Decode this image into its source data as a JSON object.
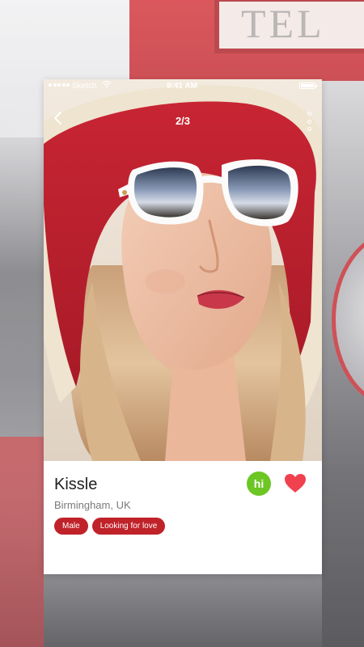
{
  "status_bar": {
    "carrier": "Sketch",
    "time": "9:41 AM",
    "wifi_icon": "wifi-icon",
    "battery_icon": "battery-icon"
  },
  "background": {
    "sign_text": "TEL"
  },
  "header": {
    "back_icon": "chevron-left-icon",
    "photo_counter": "2/3",
    "more_icon": "more-vertical-icon"
  },
  "profile": {
    "name": "Kissle",
    "location": "Birmingham, UK",
    "tags": [
      "Male",
      "Looking for love"
    ],
    "hi_label": "hi",
    "like_icon": "heart-icon"
  },
  "colors": {
    "accent_red": "#c0222a",
    "heart": "#f0414f",
    "hi_green": "#6cc623"
  }
}
